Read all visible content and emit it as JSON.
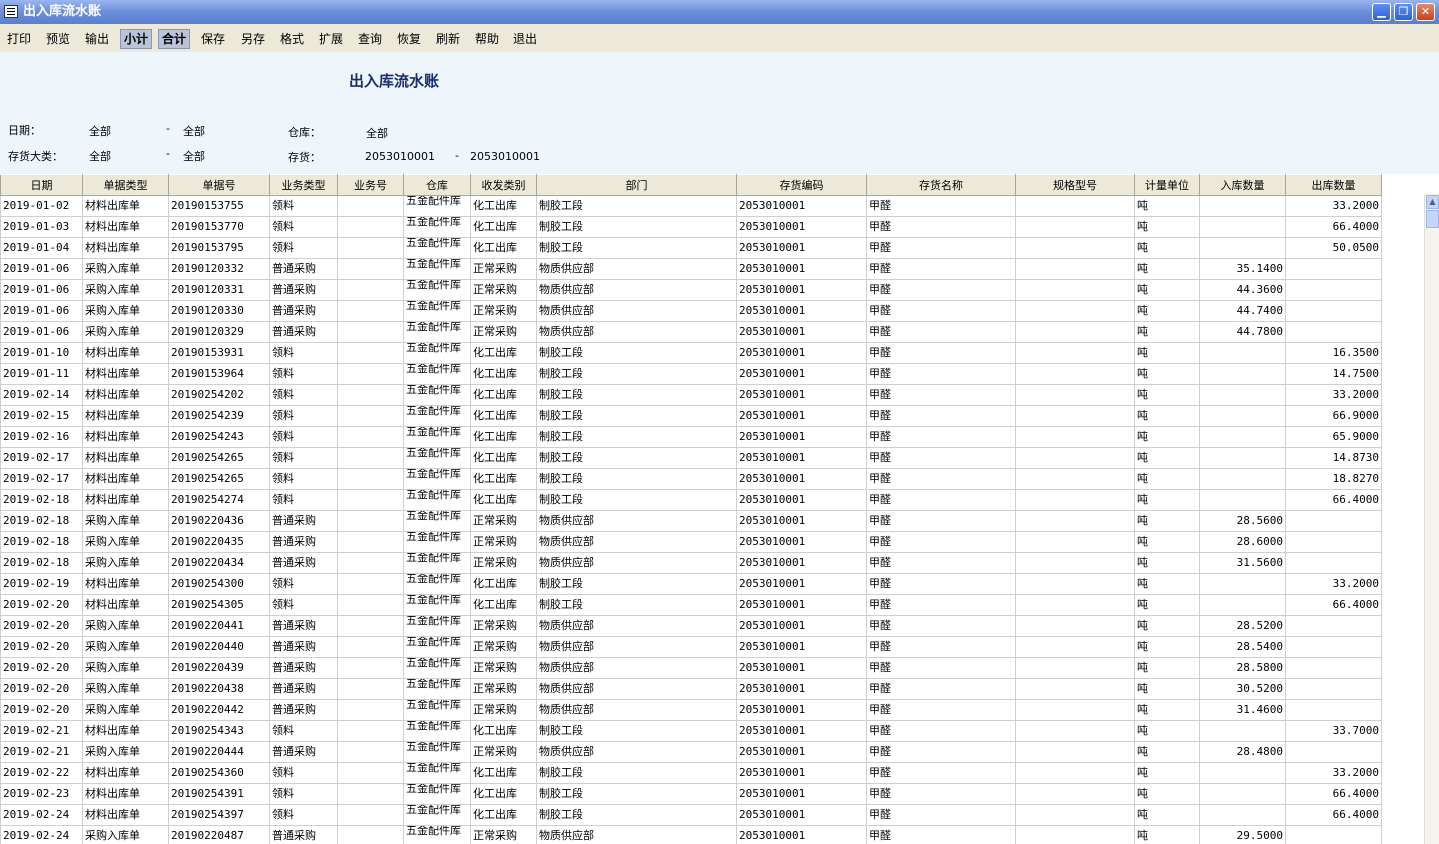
{
  "window": {
    "title": "出入库流水账",
    "minimize": "▁",
    "restore": "❐",
    "close": "✕"
  },
  "toolbar": [
    {
      "label": "打印",
      "name": "print-button",
      "pressed": false
    },
    {
      "label": "预览",
      "name": "preview-button",
      "pressed": false
    },
    {
      "label": "输出",
      "name": "export-button",
      "pressed": false
    },
    {
      "label": "小计",
      "name": "subtotal-button",
      "pressed": true
    },
    {
      "label": "合计",
      "name": "total-button",
      "pressed": true
    },
    {
      "label": "保存",
      "name": "save-button",
      "pressed": false
    },
    {
      "label": "另存",
      "name": "save-as-button",
      "pressed": false
    },
    {
      "label": "格式",
      "name": "format-button",
      "pressed": false
    },
    {
      "label": "扩展",
      "name": "extend-button",
      "pressed": false
    },
    {
      "label": "查询",
      "name": "query-button",
      "pressed": false
    },
    {
      "label": "恢复",
      "name": "restore-button",
      "pressed": false
    },
    {
      "label": "刷新",
      "name": "refresh-button",
      "pressed": false
    },
    {
      "label": "帮助",
      "name": "help-button",
      "pressed": false
    },
    {
      "label": "退出",
      "name": "exit-button",
      "pressed": false
    }
  ],
  "report": {
    "title": "出入库流水账",
    "date_label": "日期：",
    "date_from": "全部",
    "date_sep": "-",
    "date_to": "全部",
    "warehouse_label": "仓库：",
    "warehouse_value": "全部",
    "category_label": "存货大类：",
    "category_from": "全部",
    "category_sep": "-",
    "category_to": "全部",
    "inventory_label": "存货：",
    "inventory_from": "2053010001",
    "inventory_sep": "-",
    "inventory_to": "2053010001"
  },
  "columns": [
    "日期",
    "单据类型",
    "单据号",
    "业务类型",
    "业务号",
    "仓库",
    "收发类别",
    "部门",
    "存货编码",
    "存货名称",
    "规格型号",
    "计量单位",
    "入库数量",
    "出库数量"
  ],
  "rows": [
    [
      "2019-01-02",
      "材料出库单",
      "20190153755",
      "领料",
      "",
      "五金配件库",
      "化工出库",
      "制胶工段",
      "2053010001",
      "甲醛",
      "",
      "吨",
      "",
      "33.2000"
    ],
    [
      "2019-01-03",
      "材料出库单",
      "20190153770",
      "领料",
      "",
      "五金配件库",
      "化工出库",
      "制胶工段",
      "2053010001",
      "甲醛",
      "",
      "吨",
      "",
      "66.4000"
    ],
    [
      "2019-01-04",
      "材料出库单",
      "20190153795",
      "领料",
      "",
      "五金配件库",
      "化工出库",
      "制胶工段",
      "2053010001",
      "甲醛",
      "",
      "吨",
      "",
      "50.0500"
    ],
    [
      "2019-01-06",
      "采购入库单",
      "20190120332",
      "普通采购",
      "",
      "五金配件库",
      "正常采购",
      "物质供应部",
      "2053010001",
      "甲醛",
      "",
      "吨",
      "35.1400",
      ""
    ],
    [
      "2019-01-06",
      "采购入库单",
      "20190120331",
      "普通采购",
      "",
      "五金配件库",
      "正常采购",
      "物质供应部",
      "2053010001",
      "甲醛",
      "",
      "吨",
      "44.3600",
      ""
    ],
    [
      "2019-01-06",
      "采购入库单",
      "20190120330",
      "普通采购",
      "",
      "五金配件库",
      "正常采购",
      "物质供应部",
      "2053010001",
      "甲醛",
      "",
      "吨",
      "44.7400",
      ""
    ],
    [
      "2019-01-06",
      "采购入库单",
      "20190120329",
      "普通采购",
      "",
      "五金配件库",
      "正常采购",
      "物质供应部",
      "2053010001",
      "甲醛",
      "",
      "吨",
      "44.7800",
      ""
    ],
    [
      "2019-01-10",
      "材料出库单",
      "20190153931",
      "领料",
      "",
      "五金配件库",
      "化工出库",
      "制胶工段",
      "2053010001",
      "甲醛",
      "",
      "吨",
      "",
      "16.3500"
    ],
    [
      "2019-01-11",
      "材料出库单",
      "20190153964",
      "领料",
      "",
      "五金配件库",
      "化工出库",
      "制胶工段",
      "2053010001",
      "甲醛",
      "",
      "吨",
      "",
      "14.7500"
    ],
    [
      "2019-02-14",
      "材料出库单",
      "20190254202",
      "领料",
      "",
      "五金配件库",
      "化工出库",
      "制胶工段",
      "2053010001",
      "甲醛",
      "",
      "吨",
      "",
      "33.2000"
    ],
    [
      "2019-02-15",
      "材料出库单",
      "20190254239",
      "领料",
      "",
      "五金配件库",
      "化工出库",
      "制胶工段",
      "2053010001",
      "甲醛",
      "",
      "吨",
      "",
      "66.9000"
    ],
    [
      "2019-02-16",
      "材料出库单",
      "20190254243",
      "领料",
      "",
      "五金配件库",
      "化工出库",
      "制胶工段",
      "2053010001",
      "甲醛",
      "",
      "吨",
      "",
      "65.9000"
    ],
    [
      "2019-02-17",
      "材料出库单",
      "20190254265",
      "领料",
      "",
      "五金配件库",
      "化工出库",
      "制胶工段",
      "2053010001",
      "甲醛",
      "",
      "吨",
      "",
      "14.8730"
    ],
    [
      "2019-02-17",
      "材料出库单",
      "20190254265",
      "领料",
      "",
      "五金配件库",
      "化工出库",
      "制胶工段",
      "2053010001",
      "甲醛",
      "",
      "吨",
      "",
      "18.8270"
    ],
    [
      "2019-02-18",
      "材料出库单",
      "20190254274",
      "领料",
      "",
      "五金配件库",
      "化工出库",
      "制胶工段",
      "2053010001",
      "甲醛",
      "",
      "吨",
      "",
      "66.4000"
    ],
    [
      "2019-02-18",
      "采购入库单",
      "20190220436",
      "普通采购",
      "",
      "五金配件库",
      "正常采购",
      "物质供应部",
      "2053010001",
      "甲醛",
      "",
      "吨",
      "28.5600",
      ""
    ],
    [
      "2019-02-18",
      "采购入库单",
      "20190220435",
      "普通采购",
      "",
      "五金配件库",
      "正常采购",
      "物质供应部",
      "2053010001",
      "甲醛",
      "",
      "吨",
      "28.6000",
      ""
    ],
    [
      "2019-02-18",
      "采购入库单",
      "20190220434",
      "普通采购",
      "",
      "五金配件库",
      "正常采购",
      "物质供应部",
      "2053010001",
      "甲醛",
      "",
      "吨",
      "31.5600",
      ""
    ],
    [
      "2019-02-19",
      "材料出库单",
      "20190254300",
      "领料",
      "",
      "五金配件库",
      "化工出库",
      "制胶工段",
      "2053010001",
      "甲醛",
      "",
      "吨",
      "",
      "33.2000"
    ],
    [
      "2019-02-20",
      "材料出库单",
      "20190254305",
      "领料",
      "",
      "五金配件库",
      "化工出库",
      "制胶工段",
      "2053010001",
      "甲醛",
      "",
      "吨",
      "",
      "66.4000"
    ],
    [
      "2019-02-20",
      "采购入库单",
      "20190220441",
      "普通采购",
      "",
      "五金配件库",
      "正常采购",
      "物质供应部",
      "2053010001",
      "甲醛",
      "",
      "吨",
      "28.5200",
      ""
    ],
    [
      "2019-02-20",
      "采购入库单",
      "20190220440",
      "普通采购",
      "",
      "五金配件库",
      "正常采购",
      "物质供应部",
      "2053010001",
      "甲醛",
      "",
      "吨",
      "28.5400",
      ""
    ],
    [
      "2019-02-20",
      "采购入库单",
      "20190220439",
      "普通采购",
      "",
      "五金配件库",
      "正常采购",
      "物质供应部",
      "2053010001",
      "甲醛",
      "",
      "吨",
      "28.5800",
      ""
    ],
    [
      "2019-02-20",
      "采购入库单",
      "20190220438",
      "普通采购",
      "",
      "五金配件库",
      "正常采购",
      "物质供应部",
      "2053010001",
      "甲醛",
      "",
      "吨",
      "30.5200",
      ""
    ],
    [
      "2019-02-20",
      "采购入库单",
      "20190220442",
      "普通采购",
      "",
      "五金配件库",
      "正常采购",
      "物质供应部",
      "2053010001",
      "甲醛",
      "",
      "吨",
      "31.4600",
      ""
    ],
    [
      "2019-02-21",
      "材料出库单",
      "20190254343",
      "领料",
      "",
      "五金配件库",
      "化工出库",
      "制胶工段",
      "2053010001",
      "甲醛",
      "",
      "吨",
      "",
      "33.7000"
    ],
    [
      "2019-02-21",
      "采购入库单",
      "20190220444",
      "普通采购",
      "",
      "五金配件库",
      "正常采购",
      "物质供应部",
      "2053010001",
      "甲醛",
      "",
      "吨",
      "28.4800",
      ""
    ],
    [
      "2019-02-22",
      "材料出库单",
      "20190254360",
      "领料",
      "",
      "五金配件库",
      "化工出库",
      "制胶工段",
      "2053010001",
      "甲醛",
      "",
      "吨",
      "",
      "33.2000"
    ],
    [
      "2019-02-23",
      "材料出库单",
      "20190254391",
      "领料",
      "",
      "五金配件库",
      "化工出库",
      "制胶工段",
      "2053010001",
      "甲醛",
      "",
      "吨",
      "",
      "66.4000"
    ],
    [
      "2019-02-24",
      "材料出库单",
      "20190254397",
      "领料",
      "",
      "五金配件库",
      "化工出库",
      "制胶工段",
      "2053010001",
      "甲醛",
      "",
      "吨",
      "",
      "66.4000"
    ],
    [
      "2019-02-24",
      "采购入库单",
      "20190220487",
      "普通采购",
      "",
      "五金配件库",
      "正常采购",
      "物质供应部",
      "2053010001",
      "甲醛",
      "",
      "吨",
      "29.5000",
      ""
    ]
  ],
  "colors": {
    "titlebar": "#6f91da",
    "toolbar": "#ece9d8",
    "header_bg": "#eef5fb",
    "title_text": "#1a2f6b"
  }
}
